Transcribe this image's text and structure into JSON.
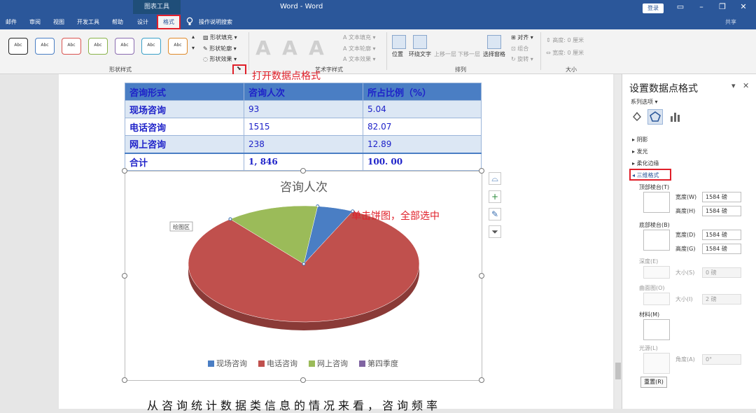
{
  "titlebar": {
    "context_group": "图表工具",
    "doc_title": "Word - Word",
    "login_label": "登录",
    "window_controls": [
      "ribbon-display-icon",
      "minimize-icon",
      "restore-icon",
      "close-icon"
    ],
    "tabs": [
      "邮件",
      "审阅",
      "视图",
      "开发工具",
      "帮助",
      "设计",
      "格式"
    ],
    "active_tab": "格式",
    "tell_me": "操作说明搜索",
    "share_label": "共享"
  },
  "ribbon": {
    "shape_style_label": "Abc",
    "shape_style_colors": [
      "#222222",
      "#4a7ec4",
      "#d9534f",
      "#8ab34a",
      "#8a6bb0",
      "#3aa0c8",
      "#e08a2a"
    ],
    "shape_fill": "形状填充",
    "shape_outline": "形状轮廓",
    "shape_effect": "形状效果",
    "group_shape_styles": "形状样式",
    "art_letter": "A",
    "text_fill": "文本填充",
    "text_outline": "文本轮廓",
    "text_effect": "文本效果",
    "group_art_styles": "艺术字样式",
    "position": "位置",
    "wrap_text": "环绕文字",
    "bring_forward": "上移一层",
    "send_backward": "下移一层",
    "selection_pane": "选择窗格",
    "align": "对齐",
    "group": "组合",
    "rotate": "旋转",
    "group_arrange": "排列",
    "height_label": "高度:",
    "width_label": "宽度:",
    "size_value": "0 厘米",
    "group_size": "大小"
  },
  "annotations": {
    "open_format": "打开数据点格式",
    "click_pie": "单击饼图，全部选中"
  },
  "table": {
    "headers": [
      "咨询形式",
      "咨询人次",
      "所占比例（%）"
    ],
    "rows": [
      [
        "现场咨询",
        "93",
        "5.04"
      ],
      [
        "电话咨询",
        "1515",
        "82.07"
      ],
      [
        "网上咨询",
        "238",
        "12.89"
      ]
    ],
    "total": [
      "合计",
      "1, 846",
      "100. 00"
    ]
  },
  "chart_data": {
    "type": "pie",
    "title": "咨询人次",
    "categories": [
      "现场咨询",
      "电话咨询",
      "网上咨询",
      "第四季度"
    ],
    "values": [
      93,
      1515,
      238,
      0
    ],
    "colors": [
      "#4a7ec4",
      "#c0504d",
      "#9bbb59",
      "#8064a2"
    ],
    "legend_position": "bottom",
    "plot_area_label": "绘图区",
    "style": "3d-tilted"
  },
  "paragraph": "从咨询统计数据类信息的情况来看，咨询频率",
  "pane": {
    "title": "设置数据点格式",
    "series_options": "系列选项",
    "sections": [
      "阴影",
      "发光",
      "柔化边缘",
      "三维格式"
    ],
    "top_bevel": "顶部棱台(T)",
    "bottom_bevel": "底部棱台(B)",
    "width_label": "宽度(W)",
    "height_label": "高度(H)",
    "width_label_d": "宽度(D)",
    "height_label_g": "高度(G)",
    "bevel_value": "1584 磅",
    "depth": "深度(E)",
    "depth_size_label": "大小(S)",
    "depth_size": "0 磅",
    "contour": "曲面图(O)",
    "contour_size_label": "大小(I)",
    "contour_size": "2 磅",
    "material": "材料(M)",
    "lighting": "光源(L)",
    "angle_label": "角度(A)",
    "angle_value": "0°",
    "reset": "重置(R)"
  }
}
